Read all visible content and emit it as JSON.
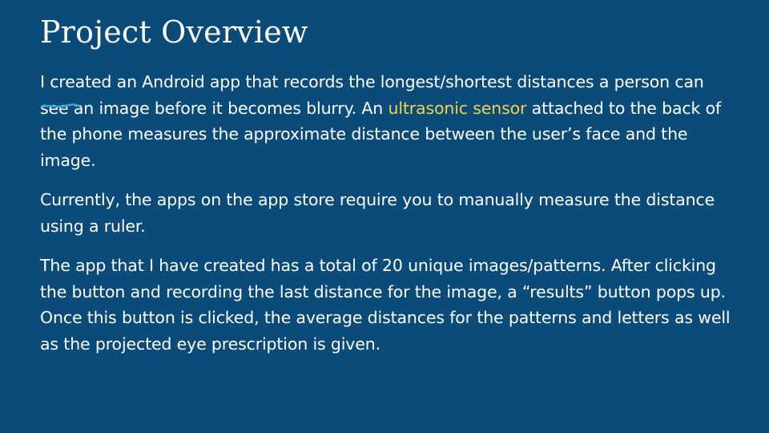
{
  "slide": {
    "title": "Project Overview",
    "paragraph1": {
      "text_before": "I created an Android app that records the longest/shortest distances a person can see an image before it becomes blurry. An ",
      "highlight": "ultrasonic sensor",
      "text_after": " attached to the back of the phone measures the approximate distance between the user’s face and the image."
    },
    "paragraph2": "Currently, the apps on the app store require you to manually measure the distance using a ruler.",
    "paragraph3": "The app that I have created has a total of 20 unique images/patterns. After clicking the button and recording the last distance for the image, a “results” button pops up. Once this button is clicked, the average distances for the patterns and letters as well as the  projected eye prescription is given."
  },
  "colors": {
    "background": "#0b4b79",
    "text": "#ffffff",
    "highlight": "#f3d34a",
    "underline": "#3aa7dc"
  }
}
